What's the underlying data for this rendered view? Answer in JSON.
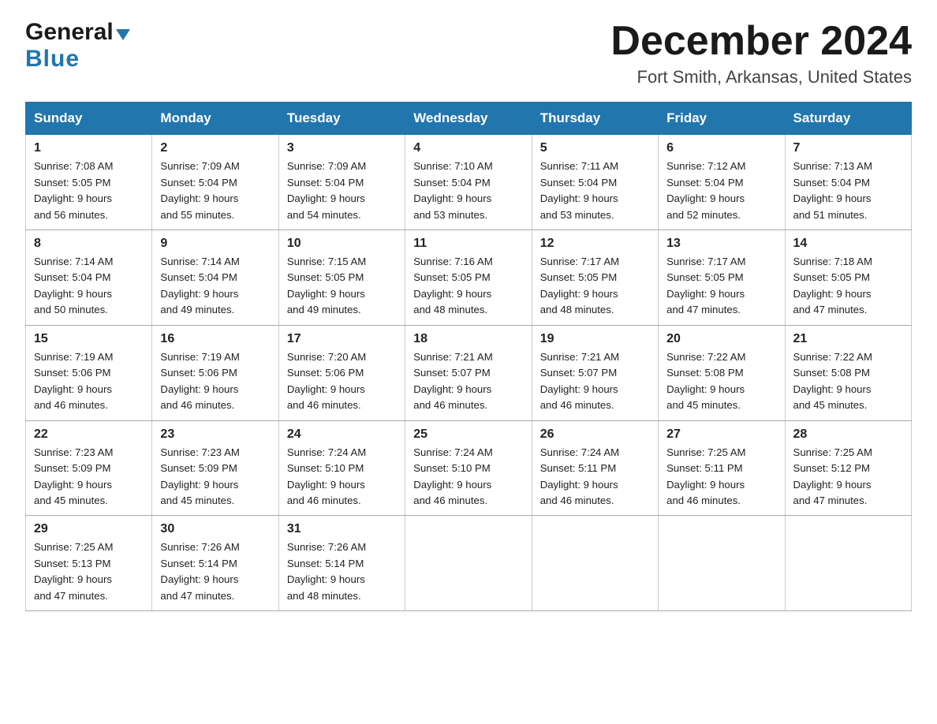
{
  "logo": {
    "general": "General",
    "triangle": "▶",
    "blue": "Blue"
  },
  "title": "December 2024",
  "subtitle": "Fort Smith, Arkansas, United States",
  "days_header": [
    "Sunday",
    "Monday",
    "Tuesday",
    "Wednesday",
    "Thursday",
    "Friday",
    "Saturday"
  ],
  "weeks": [
    [
      {
        "num": "1",
        "sunrise": "7:08 AM",
        "sunset": "5:05 PM",
        "daylight": "9 hours and 56 minutes."
      },
      {
        "num": "2",
        "sunrise": "7:09 AM",
        "sunset": "5:04 PM",
        "daylight": "9 hours and 55 minutes."
      },
      {
        "num": "3",
        "sunrise": "7:09 AM",
        "sunset": "5:04 PM",
        "daylight": "9 hours and 54 minutes."
      },
      {
        "num": "4",
        "sunrise": "7:10 AM",
        "sunset": "5:04 PM",
        "daylight": "9 hours and 53 minutes."
      },
      {
        "num": "5",
        "sunrise": "7:11 AM",
        "sunset": "5:04 PM",
        "daylight": "9 hours and 53 minutes."
      },
      {
        "num": "6",
        "sunrise": "7:12 AM",
        "sunset": "5:04 PM",
        "daylight": "9 hours and 52 minutes."
      },
      {
        "num": "7",
        "sunrise": "7:13 AM",
        "sunset": "5:04 PM",
        "daylight": "9 hours and 51 minutes."
      }
    ],
    [
      {
        "num": "8",
        "sunrise": "7:14 AM",
        "sunset": "5:04 PM",
        "daylight": "9 hours and 50 minutes."
      },
      {
        "num": "9",
        "sunrise": "7:14 AM",
        "sunset": "5:04 PM",
        "daylight": "9 hours and 49 minutes."
      },
      {
        "num": "10",
        "sunrise": "7:15 AM",
        "sunset": "5:05 PM",
        "daylight": "9 hours and 49 minutes."
      },
      {
        "num": "11",
        "sunrise": "7:16 AM",
        "sunset": "5:05 PM",
        "daylight": "9 hours and 48 minutes."
      },
      {
        "num": "12",
        "sunrise": "7:17 AM",
        "sunset": "5:05 PM",
        "daylight": "9 hours and 48 minutes."
      },
      {
        "num": "13",
        "sunrise": "7:17 AM",
        "sunset": "5:05 PM",
        "daylight": "9 hours and 47 minutes."
      },
      {
        "num": "14",
        "sunrise": "7:18 AM",
        "sunset": "5:05 PM",
        "daylight": "9 hours and 47 minutes."
      }
    ],
    [
      {
        "num": "15",
        "sunrise": "7:19 AM",
        "sunset": "5:06 PM",
        "daylight": "9 hours and 46 minutes."
      },
      {
        "num": "16",
        "sunrise": "7:19 AM",
        "sunset": "5:06 PM",
        "daylight": "9 hours and 46 minutes."
      },
      {
        "num": "17",
        "sunrise": "7:20 AM",
        "sunset": "5:06 PM",
        "daylight": "9 hours and 46 minutes."
      },
      {
        "num": "18",
        "sunrise": "7:21 AM",
        "sunset": "5:07 PM",
        "daylight": "9 hours and 46 minutes."
      },
      {
        "num": "19",
        "sunrise": "7:21 AM",
        "sunset": "5:07 PM",
        "daylight": "9 hours and 46 minutes."
      },
      {
        "num": "20",
        "sunrise": "7:22 AM",
        "sunset": "5:08 PM",
        "daylight": "9 hours and 45 minutes."
      },
      {
        "num": "21",
        "sunrise": "7:22 AM",
        "sunset": "5:08 PM",
        "daylight": "9 hours and 45 minutes."
      }
    ],
    [
      {
        "num": "22",
        "sunrise": "7:23 AM",
        "sunset": "5:09 PM",
        "daylight": "9 hours and 45 minutes."
      },
      {
        "num": "23",
        "sunrise": "7:23 AM",
        "sunset": "5:09 PM",
        "daylight": "9 hours and 45 minutes."
      },
      {
        "num": "24",
        "sunrise": "7:24 AM",
        "sunset": "5:10 PM",
        "daylight": "9 hours and 46 minutes."
      },
      {
        "num": "25",
        "sunrise": "7:24 AM",
        "sunset": "5:10 PM",
        "daylight": "9 hours and 46 minutes."
      },
      {
        "num": "26",
        "sunrise": "7:24 AM",
        "sunset": "5:11 PM",
        "daylight": "9 hours and 46 minutes."
      },
      {
        "num": "27",
        "sunrise": "7:25 AM",
        "sunset": "5:11 PM",
        "daylight": "9 hours and 46 minutes."
      },
      {
        "num": "28",
        "sunrise": "7:25 AM",
        "sunset": "5:12 PM",
        "daylight": "9 hours and 47 minutes."
      }
    ],
    [
      {
        "num": "29",
        "sunrise": "7:25 AM",
        "sunset": "5:13 PM",
        "daylight": "9 hours and 47 minutes."
      },
      {
        "num": "30",
        "sunrise": "7:26 AM",
        "sunset": "5:14 PM",
        "daylight": "9 hours and 47 minutes."
      },
      {
        "num": "31",
        "sunrise": "7:26 AM",
        "sunset": "5:14 PM",
        "daylight": "9 hours and 48 minutes."
      },
      null,
      null,
      null,
      null
    ]
  ]
}
